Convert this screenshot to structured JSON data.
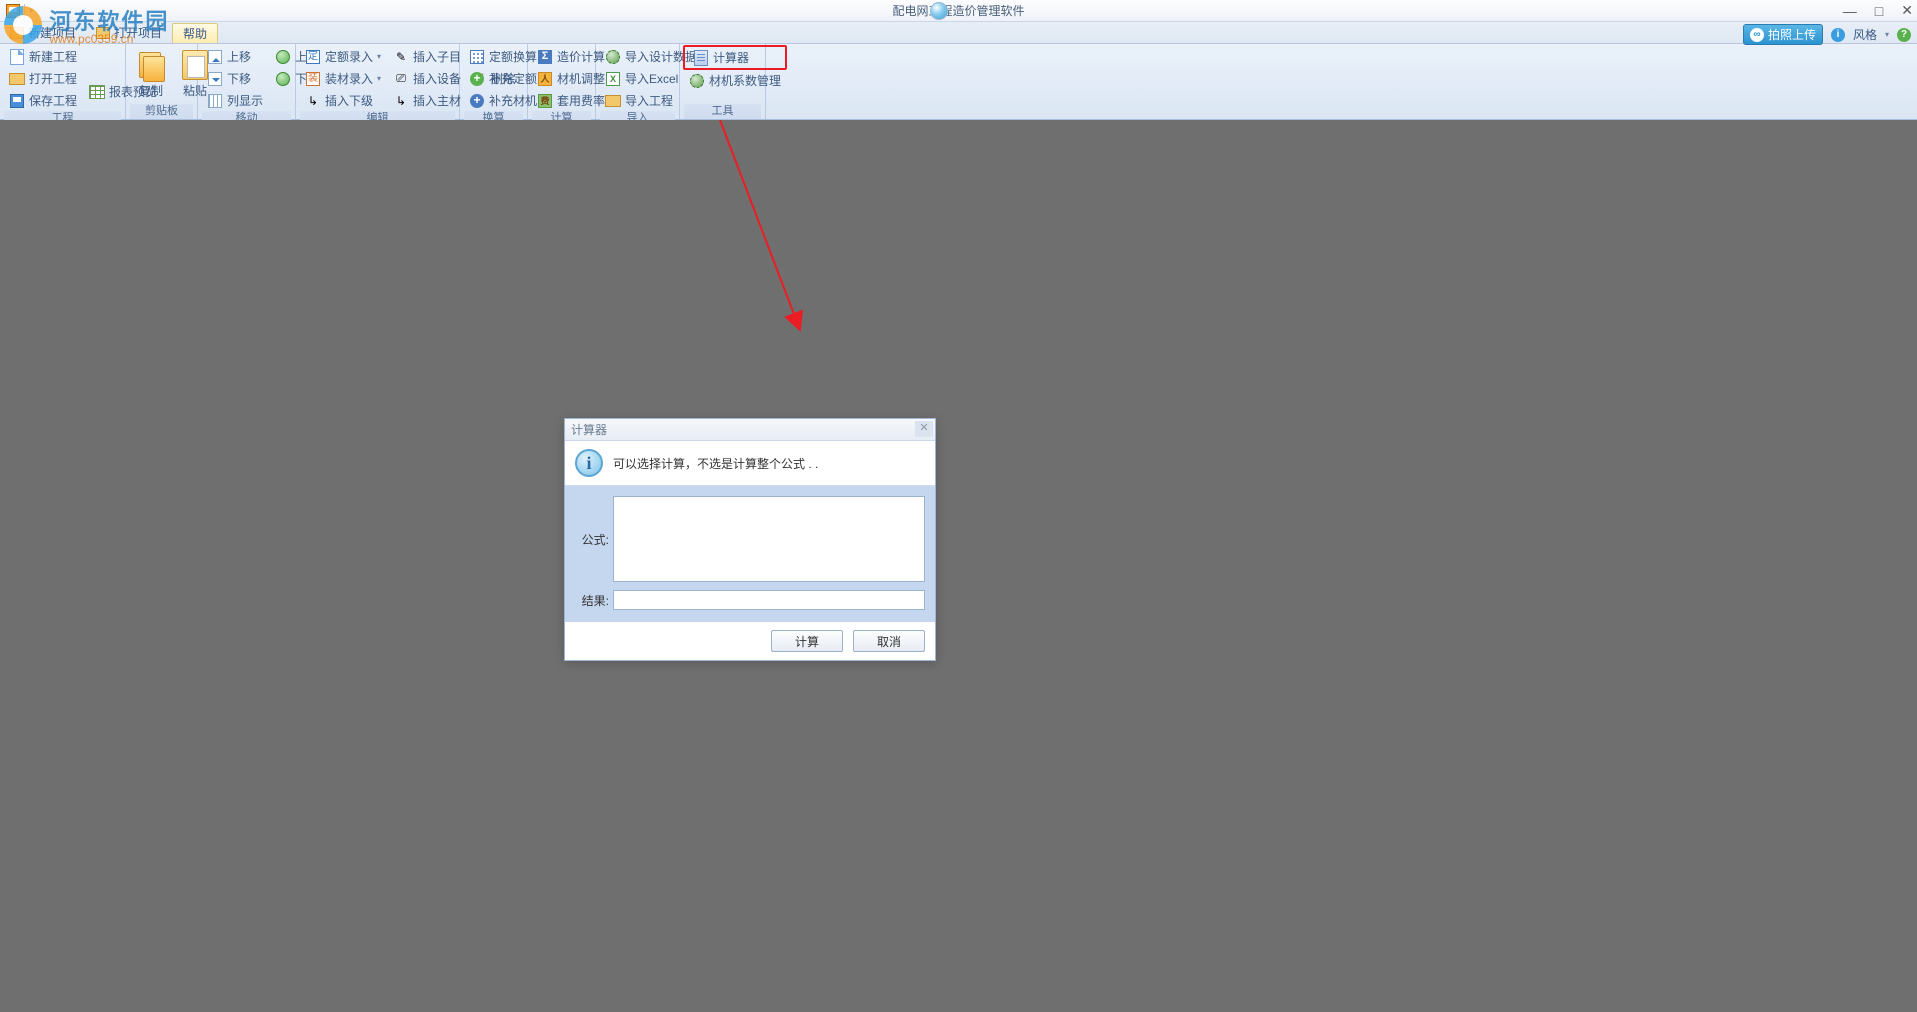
{
  "app": {
    "title": "配电网工程造价管理软件"
  },
  "watermark": {
    "brand": "河东软件园",
    "url": "www.pc0359.cn"
  },
  "titlebar": {
    "help": "帮助"
  },
  "winbtns": {
    "min": "—",
    "max": "□",
    "close": "✕"
  },
  "tabs": {
    "new_project": "新建项目",
    "open_project": "打开项目"
  },
  "status": {
    "upload": "拍照上传",
    "style": "风格"
  },
  "ribbon": {
    "project": {
      "title": "工程",
      "new": "新建工程",
      "open": "打开工程",
      "save": "保存工程",
      "report": "报表预览"
    },
    "clipboard": {
      "title": "剪贴板",
      "copy": "复制",
      "paste": "粘贴"
    },
    "move": {
      "title": "移动",
      "up": "上移",
      "down": "下移",
      "cols": "列显示",
      "level_up": "上级",
      "level_down": "下级"
    },
    "edit": {
      "title": "编辑",
      "quota_in": "定额录入",
      "sub_in": "插入子目",
      "mat_in": "装材录入",
      "dev_in": "插入设备",
      "del": "删除",
      "ins_lower": "插入下级",
      "ins_main": "插入主材"
    },
    "convert": {
      "title": "换算",
      "quota_c": "定额换算",
      "add_quota": "补充定额",
      "add_mat": "补充材机"
    },
    "calc": {
      "title": "计算",
      "cost": "造价计算",
      "mat_adj": "材机调整",
      "rate": "套用费率"
    },
    "import": {
      "title": "导入",
      "design": "导入设计数据",
      "excel": "导入Excel",
      "proj": "导入工程"
    },
    "tool": {
      "title": "工具",
      "calculator": "计算器",
      "coef": "材机系数管理"
    }
  },
  "dialog": {
    "title": "计算器",
    "hint": "可以选择计算，不选是计算整个公式 . .",
    "formula_label": "公式:",
    "result_label": "结果:",
    "btn_calc": "计算",
    "btn_cancel": "取消"
  }
}
